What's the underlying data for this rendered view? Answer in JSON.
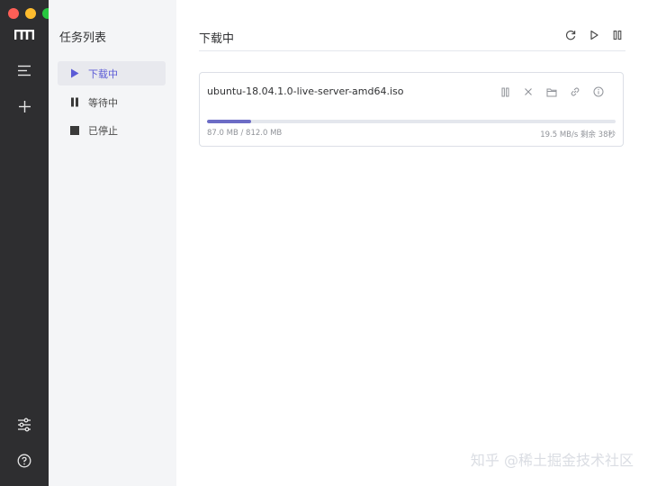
{
  "sidebar": {
    "logo_icon": "motrix-logo-icon",
    "items": [
      {
        "name": "task-list",
        "icon": "menu-lines-icon"
      },
      {
        "name": "add-task",
        "icon": "plus-icon"
      }
    ],
    "bottom": [
      {
        "name": "preferences",
        "icon": "sliders-icon"
      },
      {
        "name": "help",
        "icon": "question-circle-icon"
      }
    ]
  },
  "subnav": {
    "title": "任务列表",
    "items": [
      {
        "label": "下载中",
        "icon": "play-icon",
        "active": true
      },
      {
        "label": "等待中",
        "icon": "pause-icon",
        "active": false
      },
      {
        "label": "已停止",
        "icon": "stop-icon",
        "active": false
      }
    ]
  },
  "main": {
    "title": "下载中",
    "actions": [
      "refresh-icon",
      "resume-all-icon",
      "pause-all-icon"
    ]
  },
  "task": {
    "name": "ubuntu-18.04.1.0-live-server-amd64.iso",
    "progress": 0.107,
    "sizes": "87.0 MB / 812.0 MB",
    "speed": "19.5 MB/s 剩余 38秒",
    "actions": [
      "pause-icon",
      "delete-icon",
      "folder-icon",
      "link-icon",
      "info-icon"
    ]
  },
  "colors": {
    "rail": "#2e2e30",
    "subnav": "#f4f5f7",
    "accent": "#5b5bd6",
    "progress": "#6c6cc6"
  },
  "watermark": "知乎 @稀土掘金技术社区"
}
